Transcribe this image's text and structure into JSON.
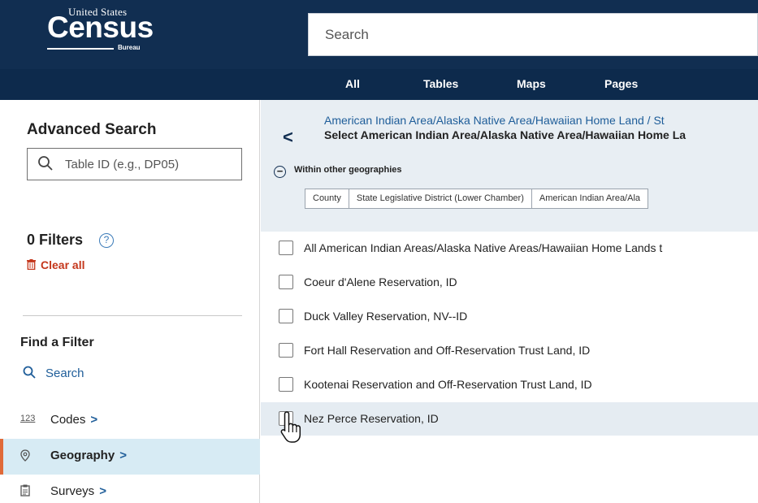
{
  "header": {
    "logo": {
      "top_text": "United States",
      "main_text": "Census",
      "sub_text": "Bureau"
    },
    "search_placeholder": "Search",
    "tabs": [
      "All",
      "Tables",
      "Maps",
      "Pages"
    ]
  },
  "sidebar": {
    "advanced_search_title": "Advanced Search",
    "table_search_placeholder": "Table ID (e.g., DP05)",
    "filters_title": "0 Filters",
    "help_glyph": "?",
    "clear_all": "Clear all",
    "find_filter_title": "Find a Filter",
    "find_search": "Search",
    "items": [
      {
        "icon": "123",
        "label": "Codes",
        "chevron": ">"
      },
      {
        "icon": "location-pin-icon",
        "label": "Geography",
        "chevron": ">"
      },
      {
        "icon": "clipboard-icon",
        "label": "Surveys",
        "chevron": ">"
      }
    ]
  },
  "main": {
    "back_glyph": "<",
    "breadcrumb": "American Indian Area/Alaska Native Area/Hawaiian Home Land / St",
    "subtitle": "Select American Indian Area/Alaska Native Area/Hawaiian Home La",
    "within_label": "Within other geographies",
    "within_glyph": "−",
    "chips": [
      "County",
      "State Legislative District (Lower Chamber)",
      "American Indian Area/Ala"
    ],
    "options": [
      "All American Indian Areas/Alaska Native Areas/Hawaiian Home Lands t",
      "Coeur d'Alene Reservation, ID",
      "Duck Valley Reservation, NV--ID",
      "Fort Hall Reservation and Off-Reservation Trust Land, ID",
      "Kootenai Reservation and Off-Reservation Trust Land, ID",
      "Nez Perce Reservation, ID"
    ]
  },
  "colors": {
    "header_bg": "#112e51",
    "nav_bg": "#0d2a4c",
    "link_blue": "#1e5d99",
    "clear_red": "#c4361b",
    "active_bg": "#d7ebf4",
    "active_accent": "#e06a39",
    "geo_head_bg": "#e8eef3"
  }
}
